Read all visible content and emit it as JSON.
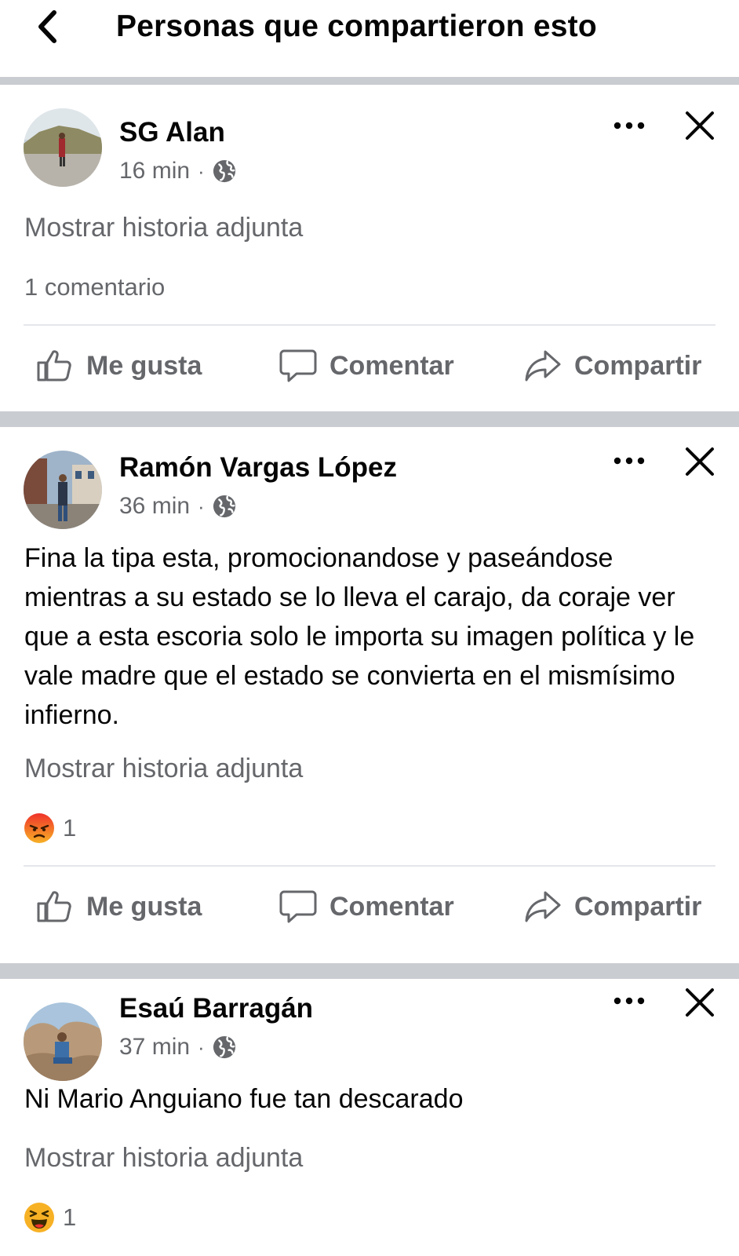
{
  "header": {
    "title": "Personas que compartieron esto",
    "back_icon": "chevron-left-icon"
  },
  "colors": {
    "text": "#050505",
    "secondary": "#65676b",
    "divider": "#c9ccd1",
    "angry_reaction": "#f36a1b",
    "haha_reaction": "#f7b125"
  },
  "actions": {
    "like": "Me gusta",
    "comment": "Comentar",
    "share": "Compartir"
  },
  "posts": [
    {
      "author": "SG Alan",
      "time": "16 min",
      "separator": "·",
      "privacy_icon": "globe-icon",
      "text": "",
      "attached_story": "Mostrar historia adjunta",
      "comments": "1 comentario"
    },
    {
      "author": "Ramón Vargas López",
      "time": "36 min",
      "separator": "·",
      "privacy_icon": "globe-icon",
      "text": "Fina la tipa esta, promocionandose y paseándose mientras a su estado se lo lleva el carajo, da coraje ver que a esta escoria solo le importa su imagen política y le vale madre que el estado se convierta en el mismísimo infierno.",
      "attached_story": "Mostrar historia adjunta",
      "reaction_icon": "angry-reaction-icon",
      "reaction_count": "1"
    },
    {
      "author": "Esaú Barragán",
      "time": "37 min",
      "separator": "·",
      "privacy_icon": "globe-icon",
      "text": "Ni Mario Anguiano fue tan descarado",
      "attached_story": "Mostrar historia adjunta",
      "reaction_icon": "haha-reaction-icon",
      "reaction_count": "1"
    }
  ]
}
